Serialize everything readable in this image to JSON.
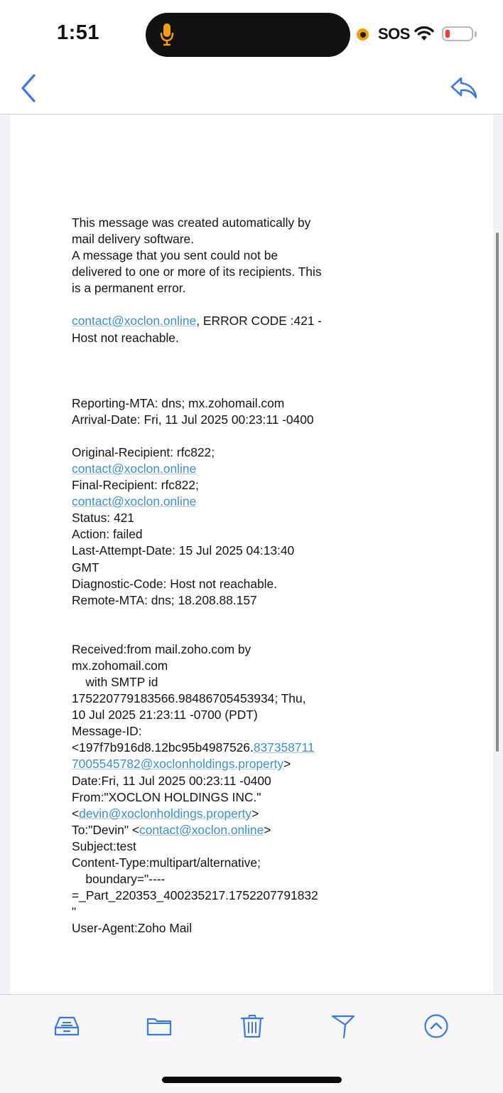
{
  "status_bar": {
    "time": "1:51",
    "sos": "SOS",
    "mic_color": "#f5a000",
    "battery_color": "#ff3b30"
  },
  "nav": {
    "back_icon": "chevron-left-icon",
    "reply_icon": "reply-icon",
    "accent": "#3478f6"
  },
  "message": {
    "intro_lines": [
      "This message was created automatically by",
      "mail delivery software.",
      "A message that you sent could not be",
      "delivered to one or more of its recipients. This",
      "is a permanent error."
    ],
    "error_link": "contact@xoclon.online",
    "error_text_1": ", ERROR CODE :421 -",
    "error_text_2": "Host not reachable.",
    "report_lines": [
      "Reporting-MTA: dns; mx.zohomail.com",
      "Arrival-Date: Fri, 11 Jul 2025 00:23:11 -0400"
    ],
    "original_recipient": "Original-Recipient: rfc822;",
    "original_recipient_link": "contact@xoclon.online",
    "final_recipient": "Final-Recipient: rfc822;",
    "final_recipient_link": "contact@xoclon.online",
    "status_lines": [
      "Status: 421",
      "Action: failed",
      "Last-Attempt-Date: 15 Jul 2025 04:13:40",
      "GMT",
      "Diagnostic-Code: Host not reachable.",
      "Remote-MTA: dns; 18.208.88.157"
    ],
    "received_lines": [
      "Received:from mail.zoho.com by",
      "mx.zohomail.com",
      "    with SMTP id",
      "175220779183566.98486705453934; Thu,",
      "10 Jul 2025 21:23:11 -0700 (PDT)",
      "Message-ID:"
    ],
    "message_id_prefix": "<197f7b916d8.12bc95b4987526.",
    "message_id_link_1": "837358711",
    "message_id_link_2": "7005545782@xoclonholdings.property",
    "message_id_suffix": ">",
    "date_line": "Date:Fri, 11 Jul 2025 00:23:11 -0400",
    "from_line": "From:\"XOCLON HOLDINGS INC.\"",
    "from_open": "<",
    "from_link": "devin@xoclonholdings.property",
    "from_close": ">",
    "to_prefix": "To:\"Devin\" <",
    "to_link": "contact@xoclon.online",
    "to_close": ">",
    "tail_lines": [
      "Subject:test",
      "Content-Type:multipart/alternative;",
      "    boundary=\"----",
      "=_Part_220353_400235217.1752207791832",
      "\"",
      "User-Agent:Zoho Mail"
    ]
  },
  "toolbar": {
    "icons": [
      "archive-icon",
      "folder-icon",
      "trash-icon",
      "flag-icon",
      "more-icon"
    ]
  }
}
